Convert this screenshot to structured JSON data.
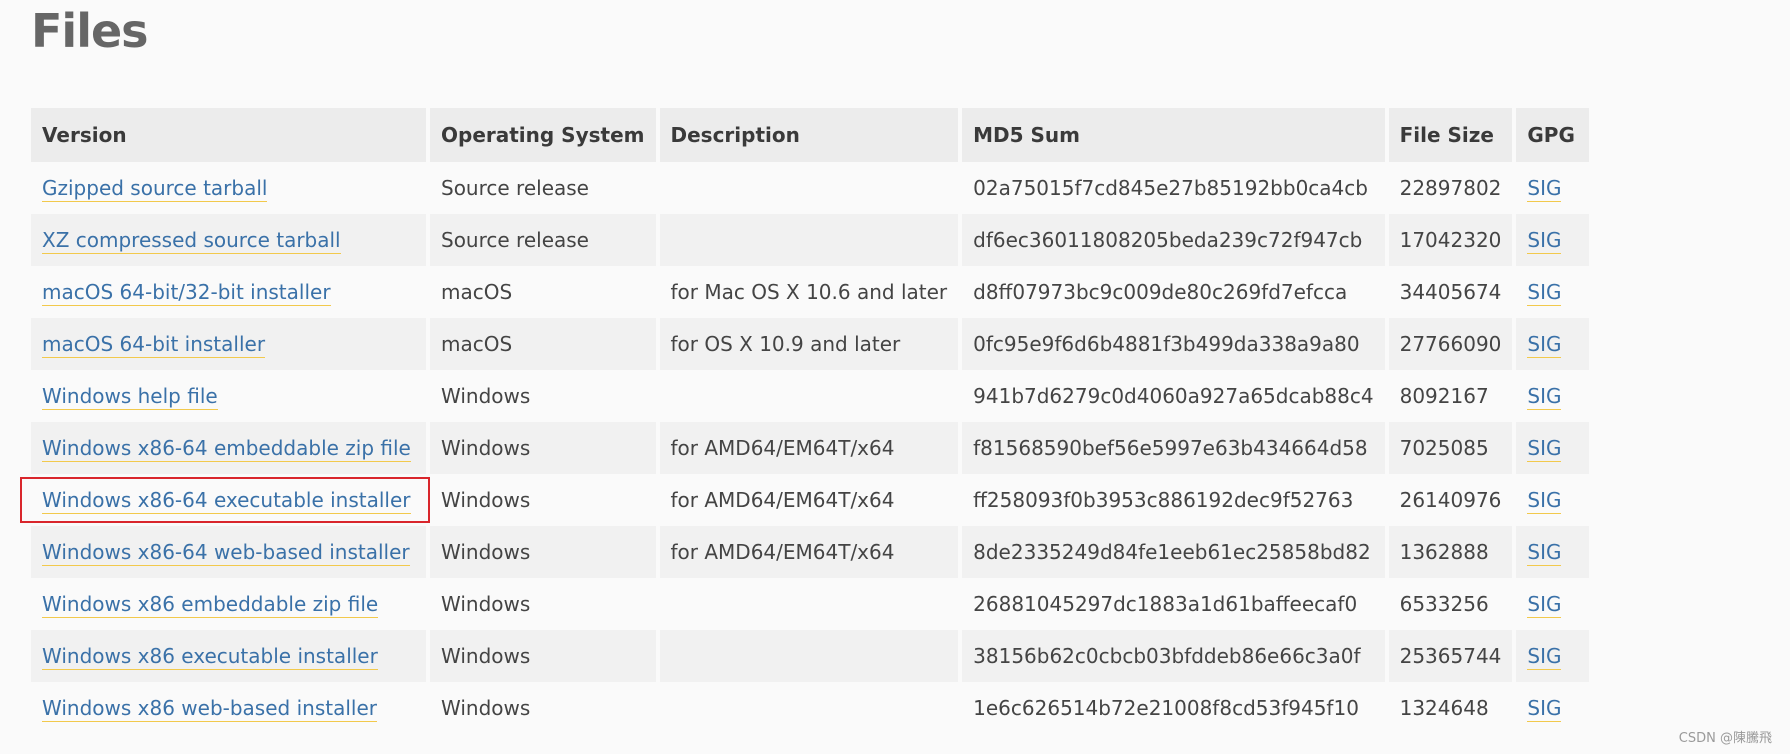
{
  "page": {
    "title": "Files",
    "watermark": "CSDN @陳騰飛"
  },
  "table": {
    "headers": [
      "Version",
      "Operating System",
      "Description",
      "MD5 Sum",
      "File Size",
      "GPG"
    ],
    "rows": [
      {
        "version": "Gzipped source tarball",
        "os": "Source release",
        "description": "",
        "md5": "02a75015f7cd845e27b85192bb0ca4cb",
        "size": "22897802",
        "gpg": "SIG"
      },
      {
        "version": "XZ compressed source tarball",
        "os": "Source release",
        "description": "",
        "md5": "df6ec36011808205beda239c72f947cb",
        "size": "17042320",
        "gpg": "SIG"
      },
      {
        "version": "macOS 64-bit/32-bit installer",
        "os": "macOS",
        "description": "for Mac OS X 10.6 and later",
        "md5": "d8ff07973bc9c009de80c269fd7efcca",
        "size": "34405674",
        "gpg": "SIG"
      },
      {
        "version": "macOS 64-bit installer",
        "os": "macOS",
        "description": "for OS X 10.9 and later",
        "md5": "0fc95e9f6d6b4881f3b499da338a9a80",
        "size": "27766090",
        "gpg": "SIG"
      },
      {
        "version": "Windows help file",
        "os": "Windows",
        "description": "",
        "md5": "941b7d6279c0d4060a927a65dcab88c4",
        "size": "8092167",
        "gpg": "SIG"
      },
      {
        "version": "Windows x86-64 embeddable zip file",
        "os": "Windows",
        "description": "for AMD64/EM64T/x64",
        "md5": "f81568590bef56e5997e63b434664d58",
        "size": "7025085",
        "gpg": "SIG"
      },
      {
        "version": "Windows x86-64 executable installer",
        "os": "Windows",
        "description": "for AMD64/EM64T/x64",
        "md5": "ff258093f0b3953c886192dec9f52763",
        "size": "26140976",
        "gpg": "SIG"
      },
      {
        "version": "Windows x86-64 web-based installer",
        "os": "Windows",
        "description": "for AMD64/EM64T/x64",
        "md5": "8de2335249d84fe1eeb61ec25858bd82",
        "size": "1362888",
        "gpg": "SIG"
      },
      {
        "version": "Windows x86 embeddable zip file",
        "os": "Windows",
        "description": "",
        "md5": "26881045297dc1883a1d61baffeecaf0",
        "size": "6533256",
        "gpg": "SIG"
      },
      {
        "version": "Windows x86 executable installer",
        "os": "Windows",
        "description": "",
        "md5": "38156b62c0cbcb03bfddeb86e66c3a0f",
        "size": "25365744",
        "gpg": "SIG"
      },
      {
        "version": "Windows x86 web-based installer",
        "os": "Windows",
        "description": "",
        "md5": "1e6c626514b72e21008f8cd53f945f10",
        "size": "1324648",
        "gpg": "SIG"
      }
    ]
  },
  "colors": {
    "link": "#3a71a8",
    "link_underline": "#f2c94c",
    "highlight": "#d9262c",
    "title": "#666666"
  }
}
